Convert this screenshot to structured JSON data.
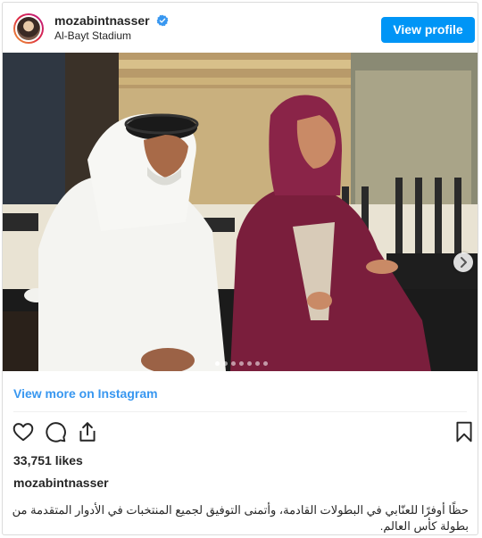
{
  "header": {
    "username": "mozabintnasser",
    "location": "Al-Bayt Stadium",
    "view_profile_label": "View profile"
  },
  "carousel": {
    "slide_count": 7,
    "active_index": 0
  },
  "links": {
    "view_more_label": "View more on Instagram"
  },
  "stats": {
    "likes": "33,751 likes"
  },
  "caption": {
    "username": "mozabintnasser",
    "text": "حظًا أوفرًا للعنّابي في البطولات القادمة، وأتمنى التوفيق لجميع المنتخبات في الأدوار المتقدمة من بطولة كأس العالم."
  },
  "colors": {
    "accent": "#0095f6",
    "link": "#3897f0",
    "verified": "#3897f0"
  },
  "icons": [
    "heart-icon",
    "comment-icon",
    "share-icon",
    "bookmark-icon",
    "verified-icon",
    "chevron-right-icon"
  ]
}
